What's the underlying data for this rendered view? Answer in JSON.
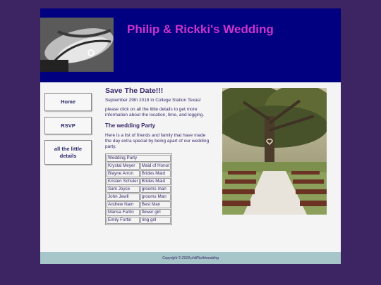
{
  "header": {
    "title": "Philip & Rickki's Wedding"
  },
  "nav": {
    "items": [
      {
        "label": "Home"
      },
      {
        "label": "RSVP"
      },
      {
        "label": "all the little details"
      }
    ]
  },
  "main": {
    "heading": "Save The Date!!!",
    "date_text": "September 29th 2018 in College Station Texas!",
    "details_text": "please click on all the little details to get more information about the location, time, and logging.",
    "party_heading": "The wedding Party",
    "party_intro": "Here is a list of friends and family that have made the day extra special by being apart of our wedding party.",
    "table": {
      "caption": "Wedding Party",
      "rows": [
        [
          "Krystal Meyer",
          "Maid of Honor"
        ],
        [
          "Blayne Arron",
          "Brides Maid"
        ],
        [
          "Kristen Schuler",
          "Brides Maid"
        ],
        [
          "Sam Joyce",
          "grooms man"
        ],
        [
          "John Jewll",
          "grooms Man"
        ],
        [
          "Andrew Nam",
          "Best Man"
        ],
        [
          "Marisa Fartin",
          "flower girl"
        ],
        [
          "Emily Fortin",
          "ring gril"
        ]
      ]
    }
  },
  "footer": {
    "copyright": "Copyright © 2018 philRickkiwedding"
  }
}
